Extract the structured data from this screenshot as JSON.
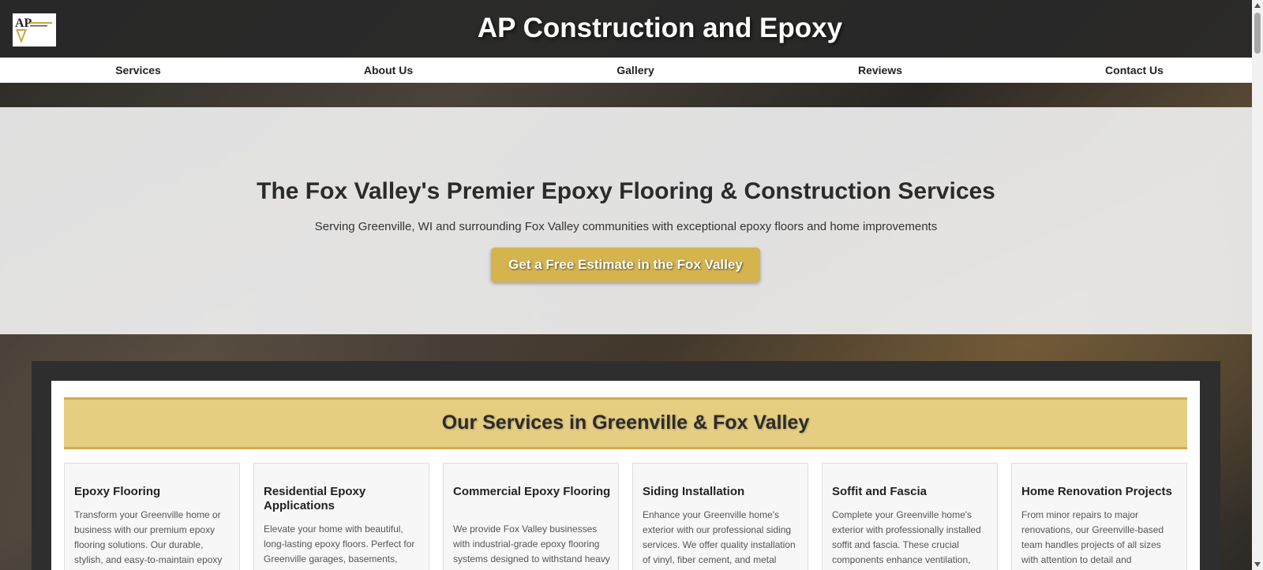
{
  "site": {
    "title": "AP Construction and Epoxy",
    "logo_text": "AP",
    "accent_color": "#d5b44e"
  },
  "nav": {
    "items": [
      {
        "label": "Services"
      },
      {
        "label": "About Us"
      },
      {
        "label": "Gallery"
      },
      {
        "label": "Reviews"
      },
      {
        "label": "Contact Us"
      }
    ]
  },
  "hero": {
    "title": "The Fox Valley's Premier Epoxy Flooring & Construction Services",
    "subtitle": "Serving Greenville, WI and surrounding Fox Valley communities with exceptional epoxy floors and home improvements",
    "cta_label": "Get a Free Estimate in the Fox Valley"
  },
  "services": {
    "heading": "Our Services in Greenville & Fox Valley",
    "cards": [
      {
        "title": "Epoxy Flooring",
        "text": "Transform your Greenville home or business with our premium epoxy flooring solutions. Our durable, stylish, and easy-to-maintain epoxy"
      },
      {
        "title": "Residential Epoxy Applications",
        "text": "Elevate your home with beautiful, long-lasting epoxy floors. Perfect for Greenville garages, basements,"
      },
      {
        "title": "Commercial Epoxy Flooring",
        "text": "We provide Fox Valley businesses with industrial-grade epoxy flooring systems designed to withstand heavy"
      },
      {
        "title": "Siding Installation",
        "text": "Enhance your Greenville home's exterior with our professional siding services. We offer quality installation of vinyl, fiber cement, and metal"
      },
      {
        "title": "Soffit and Fascia",
        "text": "Complete your Greenville home's exterior with professionally installed soffit and fascia. These crucial components enhance ventilation,"
      },
      {
        "title": "Home Renovation Projects",
        "text": "From minor repairs to major renovations, our Greenville-based team handles projects of all sizes with attention to detail and commitment to"
      }
    ]
  }
}
